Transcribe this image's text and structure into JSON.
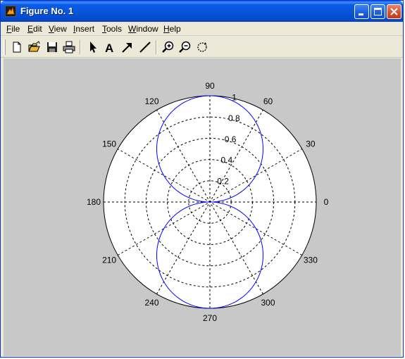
{
  "window": {
    "title": "Figure No. 1",
    "icon": "matlab-icon",
    "controls": [
      "minimize-icon",
      "maximize-icon",
      "close-icon"
    ]
  },
  "menu": [
    {
      "label": "File",
      "underline": "F",
      "rest": "ile"
    },
    {
      "label": "Edit",
      "underline": "E",
      "rest": "dit"
    },
    {
      "label": "View",
      "underline": "V",
      "rest": "iew"
    },
    {
      "label": "Insert",
      "underline": "I",
      "rest": "nsert"
    },
    {
      "label": "Tools",
      "underline": "T",
      "rest": "ools"
    },
    {
      "label": "Window",
      "underline": "W",
      "rest": "indow"
    },
    {
      "label": "Help",
      "underline": "H",
      "rest": "elp"
    }
  ],
  "toolbar": [
    "new-file-icon",
    "open-folder-icon",
    "save-icon",
    "print-icon",
    "select-arrow-icon",
    "insert-text-icon",
    "insert-arrow-icon",
    "insert-line-icon",
    "zoom-in-icon",
    "zoom-out-icon",
    "rotate-icon"
  ],
  "colors": {
    "curve": "#0000ff",
    "canvas": "#c8c8c8",
    "axes_background": "#ffffff"
  },
  "chart_data": {
    "type": "line",
    "coordinate_system": "polar",
    "function": "r = |sin(theta)|",
    "r_range": [
      0,
      1
    ],
    "r_tick_labels": [
      "0.2",
      "0.4",
      "0.6",
      "0.8",
      "1"
    ],
    "angle_tick_labels": [
      "0",
      "30",
      "60",
      "90",
      "120",
      "150",
      "180",
      "210",
      "240",
      "270",
      "300",
      "330"
    ],
    "series": [
      {
        "theta_deg": [
          0,
          15,
          30,
          45,
          60,
          75,
          90,
          105,
          120,
          135,
          150,
          165,
          180,
          195,
          210,
          225,
          240,
          255,
          270,
          285,
          300,
          315,
          330,
          345,
          360
        ],
        "r": [
          0,
          0.26,
          0.5,
          0.71,
          0.87,
          0.97,
          1,
          0.97,
          0.87,
          0.71,
          0.5,
          0.26,
          0,
          0.26,
          0.5,
          0.71,
          0.87,
          0.97,
          1,
          0.97,
          0.87,
          0.71,
          0.5,
          0.26,
          0
        ]
      }
    ],
    "grid": true
  }
}
